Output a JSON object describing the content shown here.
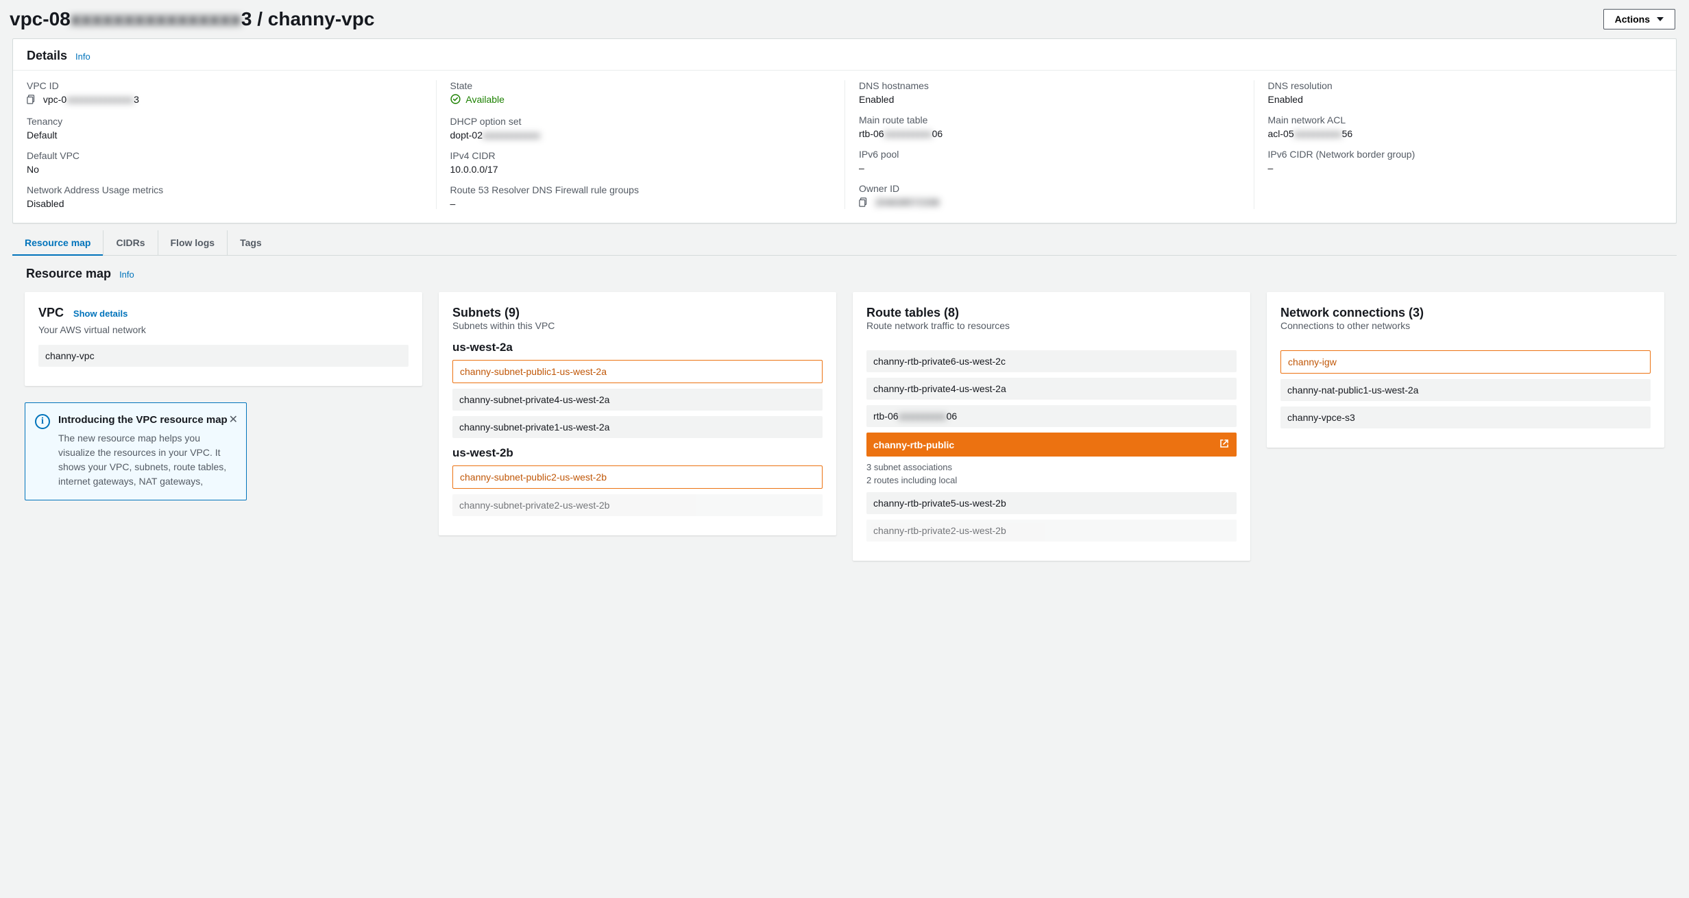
{
  "header": {
    "title_prefix": "vpc-08",
    "title_mid_blur": "xxxxxxxxxxxxxxxx",
    "title_suffix": "3 / channy-vpc",
    "actions": "Actions"
  },
  "details": {
    "title": "Details",
    "info": "Info",
    "fields": {
      "vpc_id": {
        "label": "VPC ID",
        "prefix": "vpc-0",
        "blur": "xxxxxxxxxxxxxx",
        "suffix": "3"
      },
      "state": {
        "label": "State",
        "value": "Available"
      },
      "dns_hostnames": {
        "label": "DNS hostnames",
        "value": "Enabled"
      },
      "dns_resolution": {
        "label": "DNS resolution",
        "value": "Enabled"
      },
      "tenancy": {
        "label": "Tenancy",
        "value": "Default"
      },
      "dhcp": {
        "label": "DHCP option set",
        "prefix": "dopt-02",
        "blur": "xxxxxxxxxxxx"
      },
      "main_rt": {
        "label": "Main route table",
        "prefix": "rtb-06",
        "blur": "xxxxxxxxxx",
        "suffix": "06"
      },
      "main_acl": {
        "label": "Main network ACL",
        "prefix": "acl-05",
        "blur": "xxxxxxxxxx",
        "suffix": "56"
      },
      "default_vpc": {
        "label": "Default VPC",
        "value": "No"
      },
      "ipv4_cidr": {
        "label": "IPv4 CIDR",
        "value": "10.0.0.0/17"
      },
      "ipv6_pool": {
        "label": "IPv6 pool",
        "value": "–"
      },
      "ipv6_cidr": {
        "label": "IPv6 CIDR (Network border group)",
        "value": "–"
      },
      "naum": {
        "label": "Network Address Usage metrics",
        "value": "Disabled"
      },
      "r53": {
        "label": "Route 53 Resolver DNS Firewall rule groups",
        "value": "–"
      },
      "owner": {
        "label": "Owner ID",
        "blur": "204638572338"
      }
    }
  },
  "tabs": [
    "Resource map",
    "CIDRs",
    "Flow logs",
    "Tags"
  ],
  "resource_map": {
    "title": "Resource map",
    "info": "Info",
    "vpc": {
      "heading": "VPC",
      "show_details": "Show details",
      "desc": "Your AWS virtual network",
      "name": "channy-vpc"
    },
    "subnets": {
      "heading": "Subnets (9)",
      "desc": "Subnets within this VPC",
      "az_a": "us-west-2a",
      "a1": "channy-subnet-public1-us-west-2a",
      "a2": "channy-subnet-private4-us-west-2a",
      "a3": "channy-subnet-private1-us-west-2a",
      "az_b": "us-west-2b",
      "b1": "channy-subnet-public2-us-west-2b",
      "b2": "channy-subnet-private2-us-west-2b"
    },
    "route_tables": {
      "heading": "Route tables (8)",
      "desc": "Route network traffic to resources",
      "r1": "channy-rtb-private6-us-west-2c",
      "r2": "channy-rtb-private4-us-west-2a",
      "r3_prefix": "rtb-06",
      "r3_blur": "xxxxxxxxxx",
      "r3_suffix": "06",
      "r4": "channy-rtb-public",
      "r4_sub1": "3 subnet associations",
      "r4_sub2": "2 routes including local",
      "r5": "channy-rtb-private5-us-west-2b",
      "r6": "channy-rtb-private2-us-west-2b"
    },
    "netconn": {
      "heading": "Network connections (3)",
      "desc": "Connections to other networks",
      "n1": "channy-igw",
      "n2": "channy-nat-public1-us-west-2a",
      "n3": "channy-vpce-s3"
    }
  },
  "notice": {
    "title": "Introducing the VPC resource map",
    "body": "The new resource map helps you visualize the resources in your VPC. It shows your VPC, subnets, route tables, internet gateways, NAT gateways,"
  }
}
